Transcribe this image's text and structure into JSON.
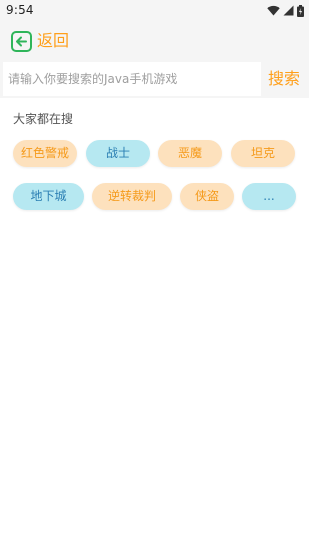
{
  "status_bar": {
    "time": "9:54",
    "icons": [
      "wifi-icon",
      "cell-signal-icon",
      "battery-icon"
    ]
  },
  "header": {
    "back_icon": "back-arrow-icon",
    "back_label": "返回",
    "accent_color": "#ff9f1a",
    "icon_color": "#2fb55a"
  },
  "search": {
    "placeholder": "请输入你要搜索的Java手机游戏",
    "value": "",
    "button_label": "搜索"
  },
  "hot_searches": {
    "title": "大家都在搜",
    "tags": [
      {
        "label": "红色警戒",
        "style": "orange"
      },
      {
        "label": "战士",
        "style": "blue"
      },
      {
        "label": "恶魔",
        "style": "orange"
      },
      {
        "label": "坦克",
        "style": "orange"
      },
      {
        "label": "地下城",
        "style": "blue"
      },
      {
        "label": "逆转裁判",
        "style": "orange"
      },
      {
        "label": "侠盗",
        "style": "orange"
      },
      {
        "label": "...",
        "style": "blue"
      }
    ],
    "colors": {
      "orange_bg": "#fde1bd",
      "orange_text": "#f59a1a",
      "blue_bg": "#b6e8f1",
      "blue_text": "#2b7fb3"
    }
  }
}
